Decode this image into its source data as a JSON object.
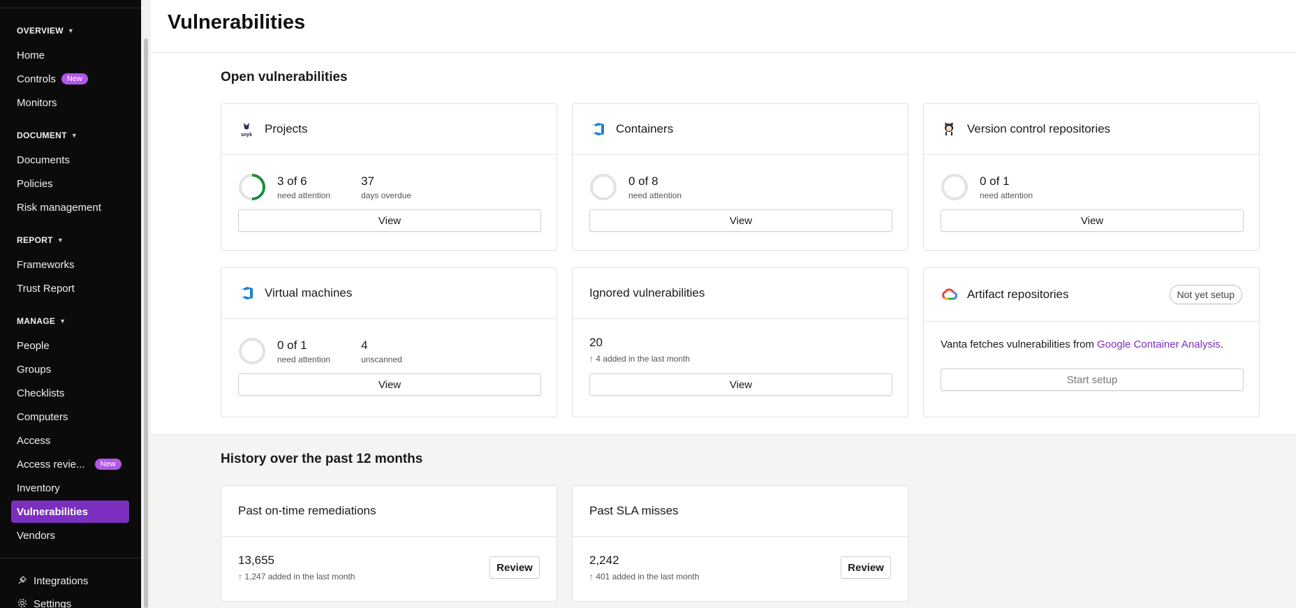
{
  "sidebar": {
    "sections": [
      {
        "title": "OVERVIEW"
      },
      {
        "title": "DOCUMENT"
      },
      {
        "title": "REPORT"
      },
      {
        "title": "MANAGE"
      }
    ],
    "items": {
      "home": "Home",
      "controls": "Controls",
      "controls_badge": "New",
      "monitors": "Monitors",
      "documents": "Documents",
      "policies": "Policies",
      "risk_management": "Risk management",
      "frameworks": "Frameworks",
      "trust_report": "Trust Report",
      "people": "People",
      "groups": "Groups",
      "checklists": "Checklists",
      "computers": "Computers",
      "access": "Access",
      "access_reviews": "Access revie...",
      "access_reviews_badge": "New",
      "inventory": "Inventory",
      "vulnerabilities": "Vulnerabilities",
      "vendors": "Vendors",
      "integrations": "Integrations",
      "settings": "Settings"
    }
  },
  "header": {
    "title": "Vulnerabilities"
  },
  "open_section": {
    "heading": "Open vulnerabilities",
    "cards": {
      "projects": {
        "title": "Projects",
        "logo": "snyk-logo",
        "stat1_num": "3 of 6",
        "stat1_sub": "need attention",
        "stat2_num": "37",
        "stat2_sub": "days overdue",
        "button": "View",
        "ring_fraction": 0.5,
        "ring_color": "#1e8e3e"
      },
      "containers": {
        "title": "Containers",
        "logo": "azure-devops-logo",
        "stat1_num": "0 of 8",
        "stat1_sub": "need attention",
        "button": "View"
      },
      "vcs": {
        "title": "Version control repositories",
        "logo": "github-octocat-logo",
        "stat1_num": "0 of 1",
        "stat1_sub": "need attention",
        "button": "View"
      },
      "vms": {
        "title": "Virtual machines",
        "logo": "azure-devops-logo",
        "stat1_num": "0 of 1",
        "stat1_sub": "need attention",
        "stat2_num": "4",
        "stat2_sub": "unscanned",
        "button": "View"
      },
      "ignored": {
        "title": "Ignored vulnerabilities",
        "num": "20",
        "sub": "↑ 4 added in the last month",
        "button": "View"
      },
      "artifact": {
        "title": "Artifact repositories",
        "logo": "google-cloud-logo",
        "badge": "Not yet setup",
        "desc_prefix": "Vanta fetches vulnerabilities from ",
        "desc_link": "Google Container Analysis",
        "desc_suffix": ".",
        "button": "Start setup"
      }
    }
  },
  "history_section": {
    "heading": "History over the past 12 months",
    "cards": {
      "ontime": {
        "title": "Past on-time remediations",
        "num": "13,655",
        "sub": "↑ 1,247 added in the last month",
        "button": "Review"
      },
      "sla": {
        "title": "Past SLA misses",
        "num": "2,242",
        "sub": "↑ 401 added in the last month",
        "button": "Review"
      }
    }
  },
  "colors": {
    "accent": "#7b2fbe",
    "badge_new": "#b157e8",
    "sidebar_bg": "#0b0b0b",
    "ring_track": "#e2e2e2"
  }
}
